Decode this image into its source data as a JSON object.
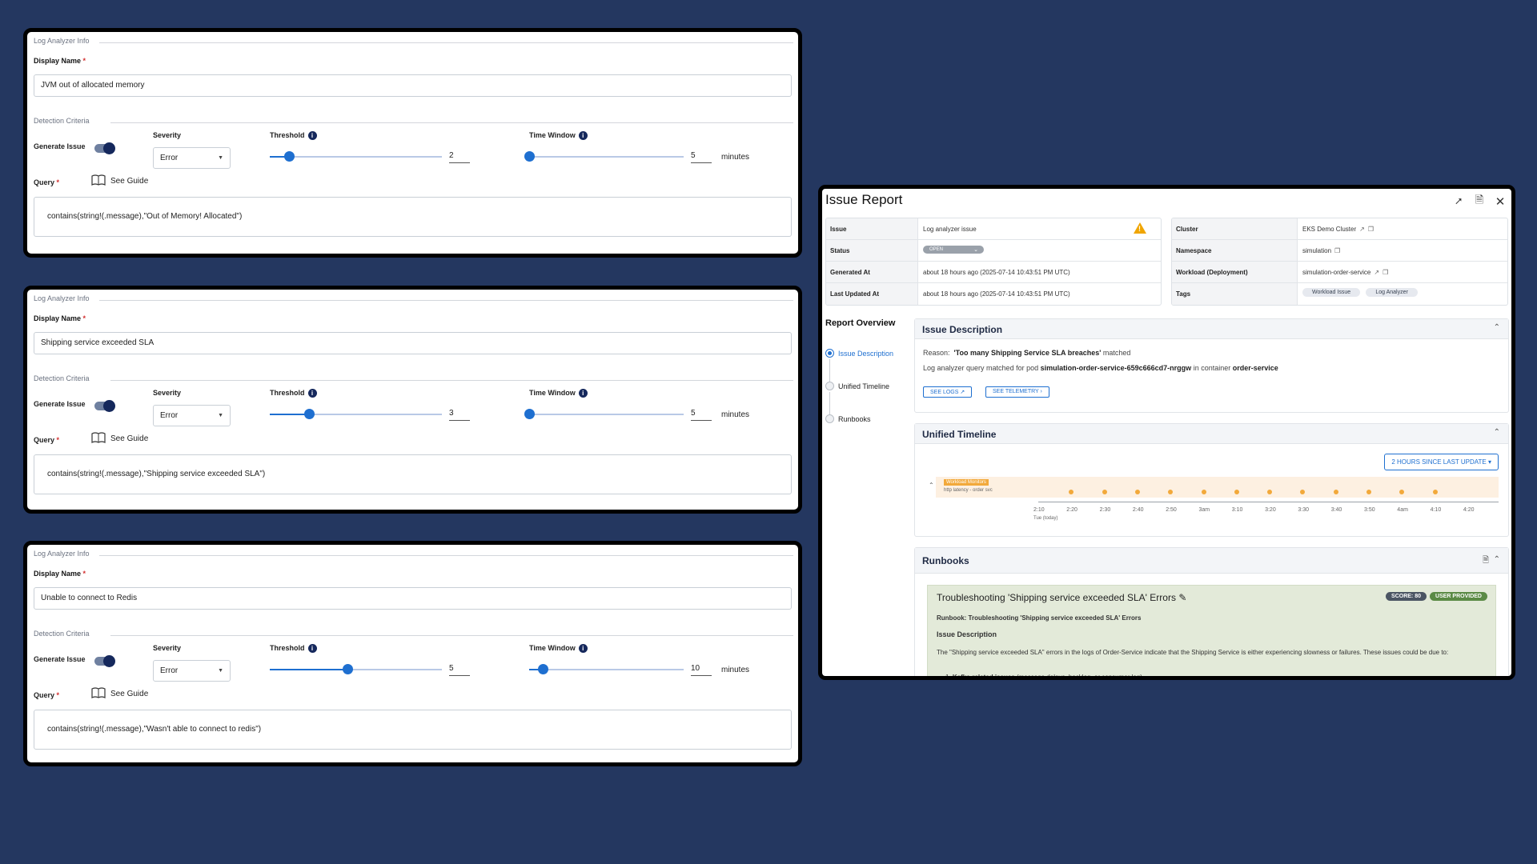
{
  "cards": [
    {
      "legend": "Log Analyzer Info",
      "display_name_label": "Display Name",
      "display_name_value": "JVM out of allocated memory",
      "detection_legend": "Detection Criteria",
      "generate_issue_label": "Generate Issue",
      "severity_label": "Severity",
      "severity_value": "Error",
      "threshold_label": "Threshold",
      "threshold_value": "2",
      "time_window_label": "Time Window",
      "time_window_value": "5",
      "minutes_label": "minutes",
      "query_label": "Query",
      "see_guide": "See Guide",
      "query_value": "contains(string!(.message),\"Out of Memory! Allocated\")"
    },
    {
      "legend": "Log Analyzer Info",
      "display_name_label": "Display Name",
      "display_name_value": "Shipping service exceeded SLA",
      "detection_legend": "Detection Criteria",
      "generate_issue_label": "Generate Issue",
      "severity_label": "Severity",
      "severity_value": "Error",
      "threshold_label": "Threshold",
      "threshold_value": "3",
      "time_window_label": "Time Window",
      "time_window_value": "5",
      "minutes_label": "minutes",
      "query_label": "Query",
      "see_guide": "See Guide",
      "query_value": "contains(string!(.message),\"Shipping service exceeded SLA\")"
    },
    {
      "legend": "Log Analyzer Info",
      "display_name_label": "Display Name",
      "display_name_value": "Unable to connect to Redis",
      "detection_legend": "Detection Criteria",
      "generate_issue_label": "Generate Issue",
      "severity_label": "Severity",
      "severity_value": "Error",
      "threshold_label": "Threshold",
      "threshold_value": "5",
      "time_window_label": "Time Window",
      "time_window_value": "10",
      "minutes_label": "minutes",
      "query_label": "Query",
      "see_guide": "See Guide",
      "query_value": "contains(string!(.message),\"Wasn't able to connect to redis\")"
    }
  ],
  "report": {
    "title": "Issue Report",
    "left_table": [
      {
        "key": "Issue",
        "value": "Log analyzer issue"
      },
      {
        "key": "Status",
        "value": "OPEN"
      },
      {
        "key": "Generated At",
        "value": "about 18 hours ago (2025-07-14 10:43:51 PM UTC)"
      },
      {
        "key": "Last Updated At",
        "value": "about 18 hours ago (2025-07-14 10:43:51 PM UTC)"
      }
    ],
    "right_table": [
      {
        "key": "Cluster",
        "value": "EKS Demo Cluster"
      },
      {
        "key": "Namespace",
        "value": "simulation"
      },
      {
        "key": "Workload (Deployment)",
        "value": "simulation-order-service"
      },
      {
        "key": "Tags",
        "tags": [
          "Workload Issue",
          "Log Analyzer"
        ]
      }
    ],
    "overview_title": "Report Overview",
    "overview_items": [
      "Issue Description",
      "Unified Timeline",
      "Runbooks"
    ],
    "issue_description": {
      "title": "Issue Description",
      "reason_label": "Reason:",
      "reason_value": "'Too many Shipping Service SLA breaches'",
      "reason_suffix": "matched",
      "line2_prefix": "Log analyzer query matched for pod",
      "pod": "simulation-order-service-659c666cd7-nrggw",
      "line2_mid": "in container",
      "container": "order-service",
      "see_logs": "SEE LOGS",
      "see_telemetry": "SEE TELEMETRY"
    },
    "timeline": {
      "title": "Unified Timeline",
      "range": "2 HOURS SINCE LAST UPDATE",
      "row_tag": "Workload Monitors",
      "row_sub": "http latency - order svc",
      "ticks": [
        "2:10",
        "2:20",
        "2:30",
        "2:40",
        "2:50",
        "3am",
        "3:10",
        "3:20",
        "3:30",
        "3:40",
        "3:50",
        "4am",
        "4:10",
        "4:20"
      ],
      "tick_sub": "Tue (today)",
      "event_count": 12
    },
    "runbooks": {
      "title": "Runbooks",
      "card_title": "Troubleshooting 'Shipping service exceeded SLA' Errors",
      "score": "SCORE: 80",
      "badge": "USER PROVIDED",
      "line1": "Runbook: Troubleshooting 'Shipping service exceeded SLA' Errors",
      "section": "Issue Description",
      "para": "The \"Shipping service exceeded SLA\" errors in the logs of Order-Service indicate that the Shipping Service is either experiencing slowness or failures. These issues could be due to:",
      "item1_bold": "Kafka-related issues",
      "item1_rest": "(message delays, backlog, or consumer lag)"
    }
  }
}
